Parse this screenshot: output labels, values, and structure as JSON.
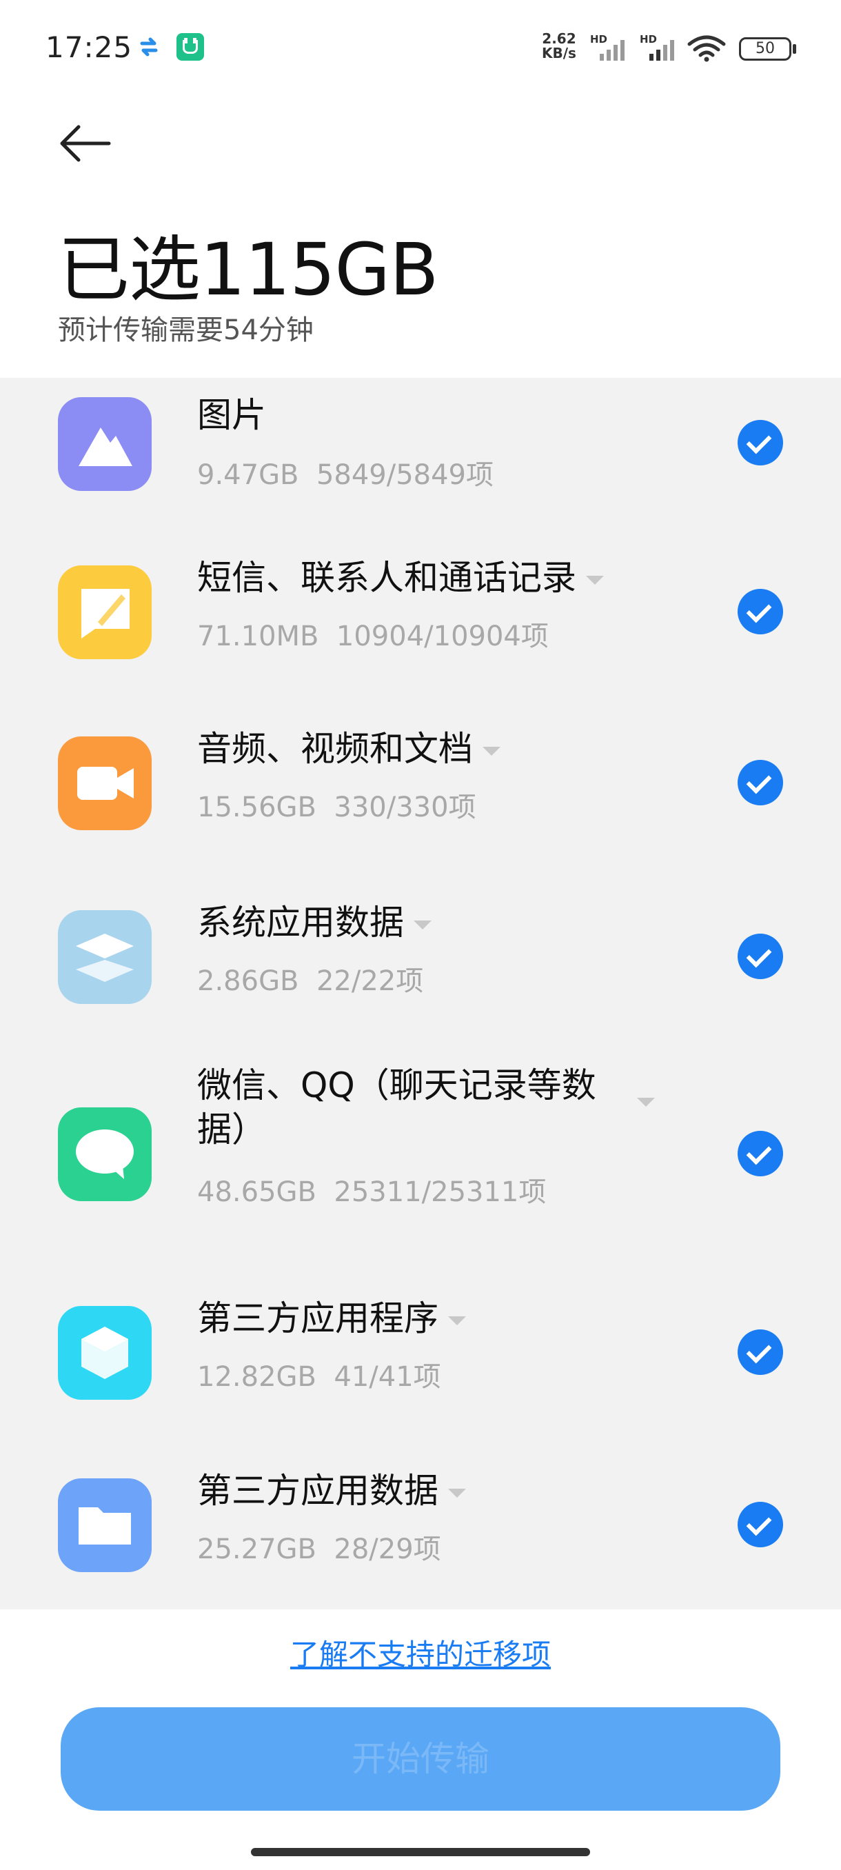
{
  "status_bar": {
    "time": "17:25",
    "net_speed_value": "2.62",
    "net_speed_unit": "KB/s",
    "signal1_label": "HD",
    "signal2_label": "HD",
    "battery": "50"
  },
  "header": {
    "title": "已选115GB",
    "subtitle": "预计传输需要54分钟"
  },
  "items": [
    {
      "title": "图片",
      "size": "9.47GB",
      "count": "5849/5849项",
      "icon": "photos-icon",
      "icon_color": "#8c8cf5",
      "expandable": false,
      "checked": true
    },
    {
      "title": "短信、联系人和通话记录",
      "size": "71.10MB",
      "count": "10904/10904项",
      "icon": "messages-icon",
      "icon_color": "#fdcb3e",
      "expandable": true,
      "checked": true
    },
    {
      "title": "音频、视频和文档",
      "size": "15.56GB",
      "count": "330/330项",
      "icon": "video-icon",
      "icon_color": "#fb9a3c",
      "expandable": true,
      "checked": true
    },
    {
      "title": "系统应用数据",
      "size": "2.86GB",
      "count": "22/22项",
      "icon": "layers-icon",
      "icon_color": "#a9d4ee",
      "expandable": true,
      "checked": true
    },
    {
      "title": "微信、QQ（聊天记录等数据）",
      "size": "48.65GB",
      "count": "25311/25311项",
      "icon": "chat-bubble-icon",
      "icon_color": "#2bd190",
      "expandable": true,
      "checked": true
    },
    {
      "title": "第三方应用程序",
      "size": "12.82GB",
      "count": "41/41项",
      "icon": "cube-icon",
      "icon_color": "#2ed8f5",
      "expandable": true,
      "checked": true
    },
    {
      "title": "第三方应用数据",
      "size": "25.27GB",
      "count": "28/29项",
      "icon": "folder-icon",
      "icon_color": "#6da3f8",
      "expandable": true,
      "checked": true
    }
  ],
  "footer": {
    "learn_link": "了解不支持的迁移项",
    "start_button": "开始传输"
  }
}
